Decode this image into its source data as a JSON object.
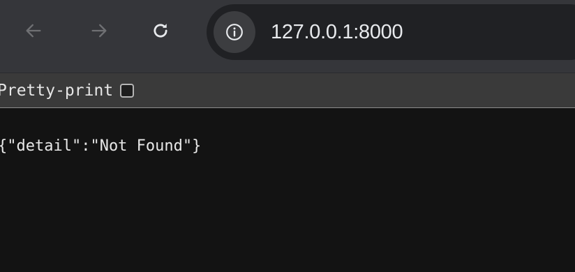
{
  "toolbar": {
    "back_icon": "arrow-left-icon",
    "forward_icon": "arrow-right-icon",
    "reload_icon": "reload-icon",
    "site_info_icon": "info-icon",
    "url": "127.0.0.1:8000"
  },
  "viewer": {
    "pretty_print_label": "Pretty-print",
    "pretty_print_checked": false,
    "body": "{\"detail\":\"Not Found\"}"
  },
  "colors": {
    "toolbar_bg": "#35363a",
    "omnibox_bg": "#202124",
    "page_bg": "#131313",
    "pp_bar_bg": "#3a3a3a",
    "text": "#e8eaed"
  }
}
